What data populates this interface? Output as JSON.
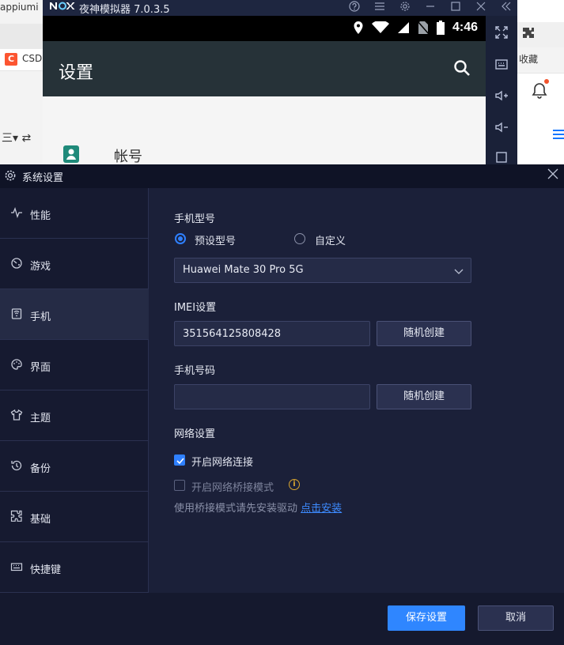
{
  "browser": {
    "tab_text": "appiumi",
    "csdn_logo": "C",
    "csdn_text": "CSD",
    "left_tool": "三▾  ⇄",
    "favorites": "收藏"
  },
  "nox": {
    "logo": "nox",
    "title": "夜神模拟器 7.0.3.5",
    "status_time": "4:46",
    "appbar_title": "设置",
    "account_label": "帐号"
  },
  "dialog": {
    "title": "系统设置",
    "nav": [
      {
        "label": "性能",
        "icon": "pulse-icon"
      },
      {
        "label": "游戏",
        "icon": "gamepad-icon"
      },
      {
        "label": "手机",
        "icon": "phone-icon"
      },
      {
        "label": "界面",
        "icon": "palette-icon"
      },
      {
        "label": "主题",
        "icon": "shirt-icon"
      },
      {
        "label": "备份",
        "icon": "history-icon"
      },
      {
        "label": "基础",
        "icon": "puzzle-icon"
      },
      {
        "label": "快捷键",
        "icon": "keyboard-icon"
      }
    ],
    "active_nav": "手机",
    "phone_model": {
      "label": "手机型号",
      "preset_label": "预设型号",
      "custom_label": "自定义",
      "selected": "Huawei Mate 30 Pro 5G"
    },
    "imei": {
      "label": "IMEI设置",
      "value": "351564125808428",
      "button": "随机创建"
    },
    "phone_number": {
      "label": "手机号码",
      "value": "",
      "button": "随机创建"
    },
    "network": {
      "label": "网络设置",
      "enable_label": "开启网络连接",
      "bridge_label": "开启网络桥接模式",
      "hint": "使用桥接模式请先安装驱动",
      "hint_link": "点击安装"
    },
    "footer": {
      "save": "保存设置",
      "cancel": "取消"
    }
  },
  "colors": {
    "accent": "#2f86ff",
    "dialog_bg": "#1b2039",
    "nav_active": "#252b45",
    "warning": "#d9a52f"
  }
}
